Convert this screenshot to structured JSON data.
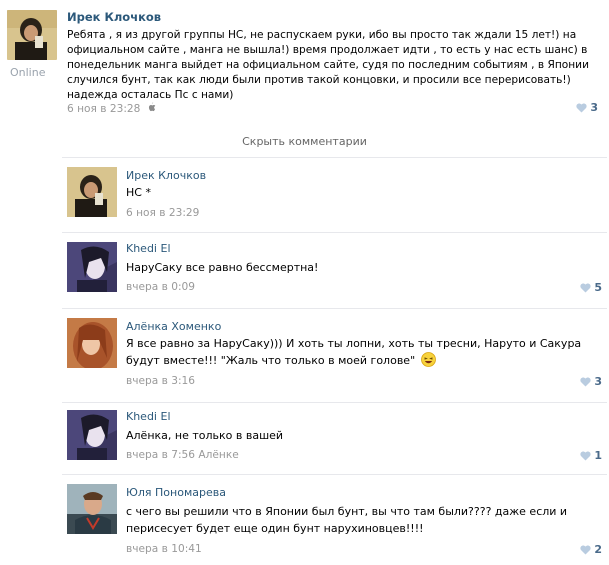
{
  "post": {
    "author": "Ирек Клочков",
    "online": "Online",
    "text": "Ребята , я из другой группы НС, не распускаем руки, ибо вы просто так ждали 15 лет!) на официальном сайте , манга не вышла!) время продолжает идти , то есть у нас есть шанс) в понедельник манга выйдет на официальном сайте, судя по последним событиям , в Японии случился бунт, так как люди были против такой концовки, и просили все перерисовать!) надежда осталась Пс с нами)",
    "date": "6 ноя в 23:28",
    "device_icon": "apple-icon",
    "likes": "3"
  },
  "hide_comments_label": "Скрыть комментарии",
  "comments": [
    {
      "author": "Ирек Клочков",
      "text": "НС *",
      "date": "6 ноя в 23:29",
      "reply_to": "",
      "likes": "",
      "avatar": "avatar-man-dark"
    },
    {
      "author": "Khedi El",
      "text": "НаруСаку все равно бессмертна!",
      "date": "вчера в 0:09",
      "reply_to": "",
      "likes": "5",
      "avatar": "avatar-anime"
    },
    {
      "author": "Алёнка Хоменко",
      "text": "Я все равно за НаруСаку))) И хоть ты лопни, хоть ты тресни, Наруто и Сакура будут вместе!!! \"Жаль что только в моей голове\"",
      "date": "вчера в 3:16",
      "reply_to": "",
      "likes": "3",
      "avatar": "avatar-girl"
    },
    {
      "author": "Khedi El",
      "text": "Алёнка, не только в вашей",
      "date": "вчера в 7:56",
      "reply_to": "Алёнке",
      "likes": "1",
      "avatar": "avatar-anime"
    },
    {
      "author": "Юля Пономарева",
      "text": "с чего вы решили что в Японии был бунт, вы что там были???? даже если и перисесует будет еще один бунт нарухиновцев!!!!",
      "date": "вчера в 10:41",
      "reply_to": "",
      "likes": "2",
      "avatar": "avatar-boy"
    }
  ],
  "colors": {
    "link": "#2b587a",
    "meta": "#999999",
    "likes": "#4a6a8a",
    "heart": "#b9cce0"
  }
}
